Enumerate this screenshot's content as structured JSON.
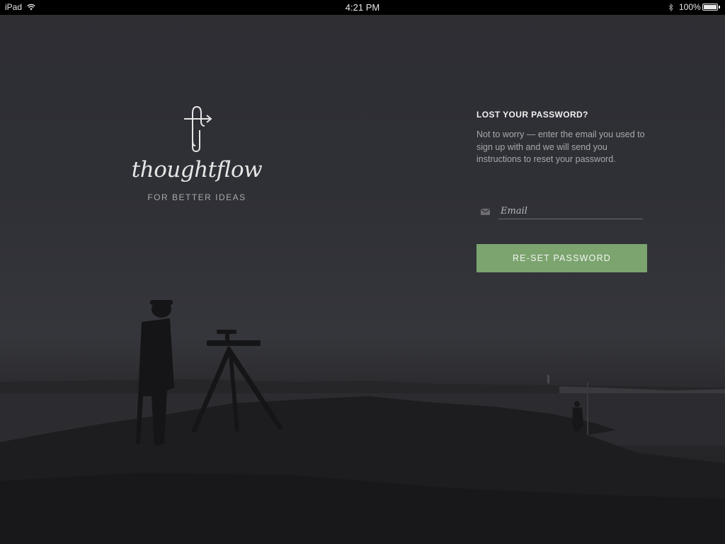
{
  "status_bar": {
    "device": "iPad",
    "time": "4:21 PM",
    "battery": "100%"
  },
  "brand": {
    "name": "thoughtflow",
    "tagline": "FOR BETTER IDEAS",
    "logo_icon": "thoughtflow-logo-icon"
  },
  "reset_form": {
    "title": "LOST YOUR PASSWORD?",
    "description": "Not to worry — enter the email you used to sign up with and we will send you instructions to reset your password.",
    "email_placeholder": "Email",
    "email_value": "",
    "email_icon": "mail-icon",
    "submit_label": "RE-SET PASSWORD"
  },
  "colors": {
    "accent": "#7ba46f",
    "background": "#2f3036",
    "status_bar": "#000000"
  }
}
